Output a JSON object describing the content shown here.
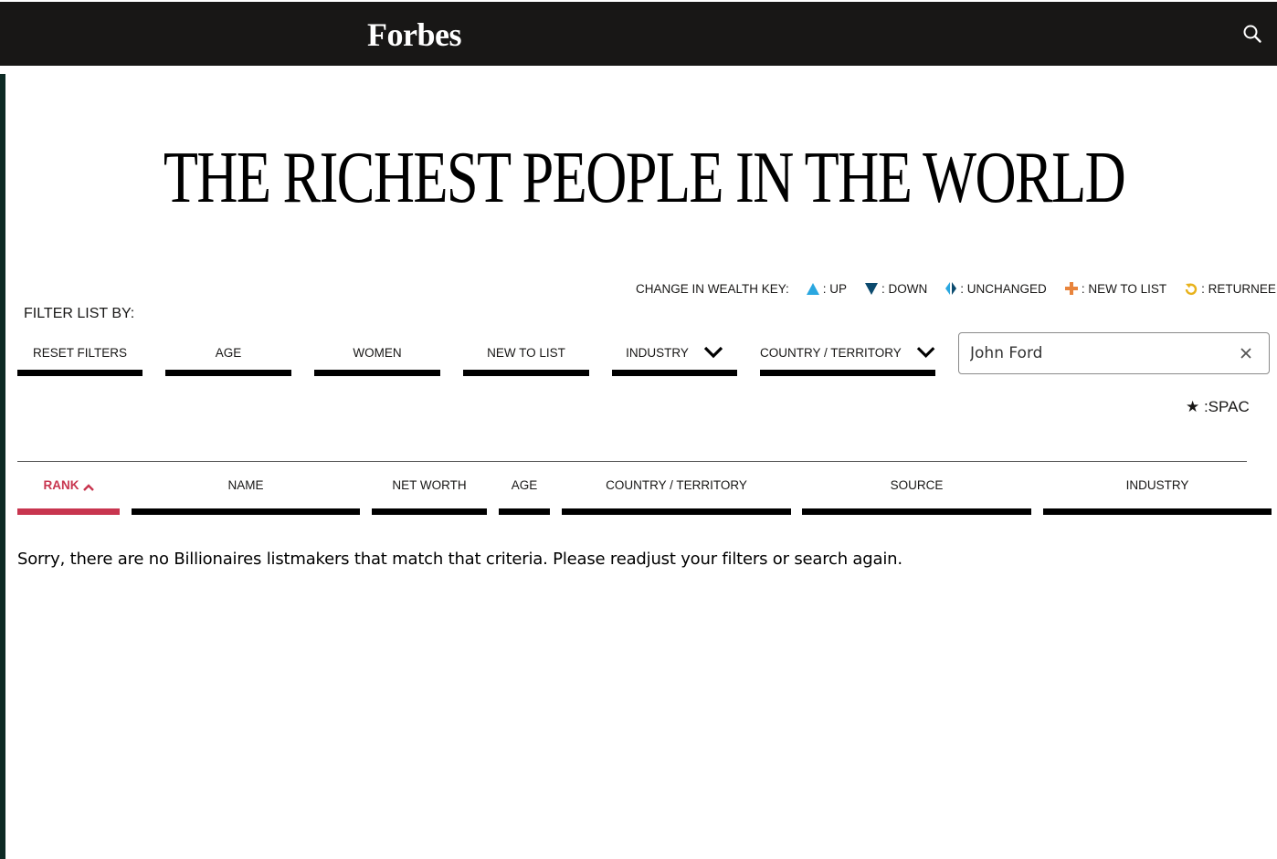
{
  "header": {
    "logo": "Forbes",
    "search_icon": "search-icon"
  },
  "page": {
    "title": "THE RICHEST PEOPLE IN THE WORLD"
  },
  "wealth_key": {
    "label": "CHANGE IN WEALTH KEY:",
    "items": [
      {
        "icon": "triangle-up-icon",
        "color": "#2aa7e0",
        "label": ": UP"
      },
      {
        "icon": "triangle-down-icon",
        "color": "#0b4a6e",
        "label": ": DOWN"
      },
      {
        "icon": "diamond-split-icon",
        "color": "#0b4a6e",
        "label": ": UNCHANGED"
      },
      {
        "icon": "plus-icon",
        "color": "#e8843c",
        "label": ": NEW TO LIST"
      },
      {
        "icon": "returnee-arrow-icon",
        "color": "#e8b21c",
        "label": ": RETURNEE"
      }
    ]
  },
  "filters": {
    "label": "FILTER LIST BY:",
    "buttons": [
      {
        "label": "RESET FILTERS"
      },
      {
        "label": "AGE"
      },
      {
        "label": "WOMEN"
      },
      {
        "label": "NEW TO LIST"
      },
      {
        "label": "INDUSTRY",
        "icon": "chevron-down-icon"
      },
      {
        "label": "COUNTRY / TERRITORY",
        "icon": "chevron-down-icon"
      }
    ],
    "search": {
      "value": "John Ford",
      "clear_icon": "close-icon"
    }
  },
  "spac_key": {
    "label": "★ :SPAC"
  },
  "table": {
    "columns": [
      {
        "label": "RANK",
        "active": true,
        "icon": "chevron-up-icon"
      },
      {
        "label": "NAME"
      },
      {
        "label": "NET WORTH"
      },
      {
        "label": "AGE"
      },
      {
        "label": "COUNTRY / TERRITORY"
      },
      {
        "label": "SOURCE"
      },
      {
        "label": "INDUSTRY"
      }
    ],
    "active_color": "#c8354f",
    "empty_message": "Sorry, there are no Billionaires listmakers that match that criteria. Please readjust your filters or search again."
  }
}
